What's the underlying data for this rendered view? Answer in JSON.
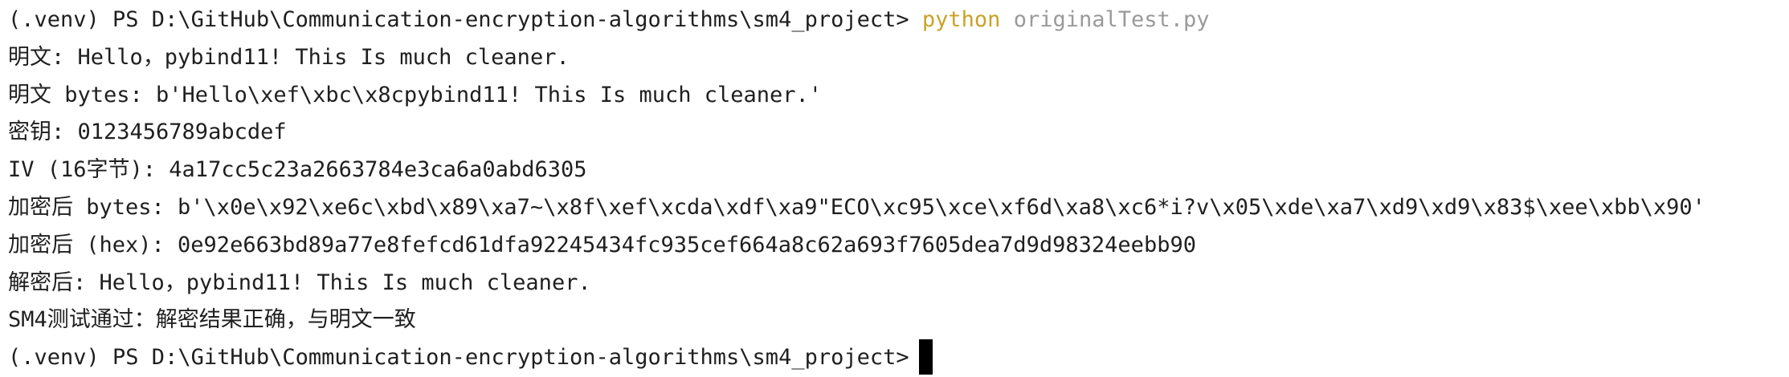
{
  "terminal": {
    "prompt": "(.venv) PS D:\\GitHub\\Communication-encryption-algorithms\\sm4_project>",
    "command": "python",
    "argument": "originalTest.py",
    "lines": [
      "明文: Hello，pybind11! This Is much cleaner.",
      "明文 bytes: b'Hello\\xef\\xbc\\x8cpybind11! This Is much cleaner.'",
      "密钥: 0123456789abcdef",
      "IV (16字节): 4a17cc5c23a2663784e3ca6a0abd6305",
      "加密后 bytes: b'\\x0e\\x92\\xe6c\\xbd\\x89\\xa7~\\x8f\\xef\\xcda\\xdf\\xa9\"ECO\\xc95\\xce\\xf6d\\xa8\\xc6*i?v\\x05\\xde\\xa7\\xd9\\xd9\\x83$\\xee\\xbb\\x90'",
      "加密后 (hex): 0e92e663bd89a77e8fefcd61dfa92245434fc935cef664a8c62a693f7605dea7d9d98324eebb90",
      "解密后: Hello，pybind11! This Is much cleaner.",
      "SM4测试通过：解密结果正确，与明文一致"
    ],
    "colors": {
      "background": "#ffffff",
      "text": "#1f1f1f",
      "command": "#c9a227",
      "argument": "#9a9a9a",
      "cursor": "#000000"
    }
  }
}
